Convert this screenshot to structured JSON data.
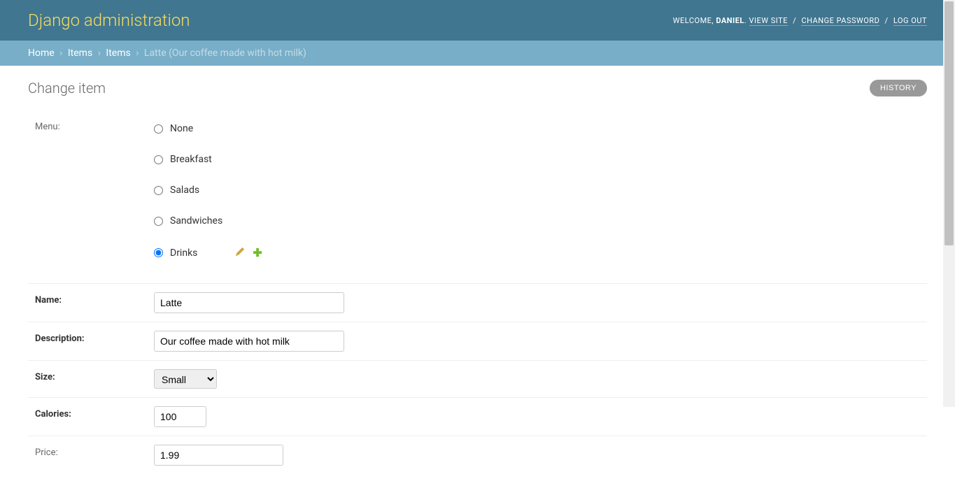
{
  "header": {
    "site_title": "Django administration",
    "welcome": "WELCOME,",
    "username": "DANIEL",
    "view_site": "VIEW SITE",
    "change_password": "CHANGE PASSWORD",
    "log_out": "LOG OUT"
  },
  "breadcrumbs": {
    "home": "Home",
    "app": "Items",
    "model": "Items",
    "current": "Latte (Our coffee made with hot milk)"
  },
  "page": {
    "title": "Change item",
    "history_label": "HISTORY"
  },
  "form": {
    "menu": {
      "label": "Menu:",
      "options": [
        "None",
        "Breakfast",
        "Salads",
        "Sandwiches",
        "Drinks"
      ],
      "selected": "Drinks"
    },
    "name": {
      "label": "Name:",
      "value": "Latte"
    },
    "description": {
      "label": "Description:",
      "value": "Our coffee made with hot milk"
    },
    "size": {
      "label": "Size:",
      "value": "Small",
      "options": [
        "Small"
      ]
    },
    "calories": {
      "label": "Calories:",
      "value": "100"
    },
    "price": {
      "label": "Price:",
      "value": "1.99"
    }
  }
}
